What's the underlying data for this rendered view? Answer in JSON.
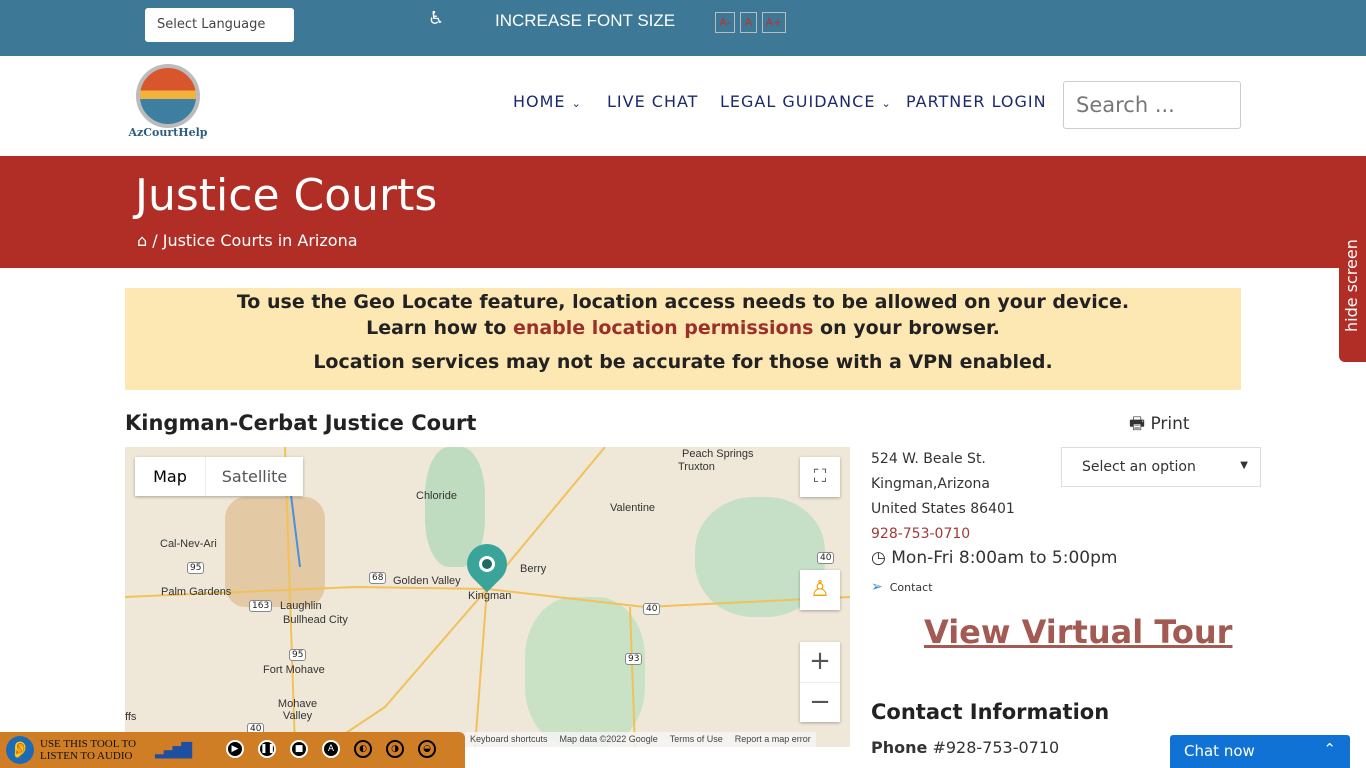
{
  "topbar": {
    "language_placeholder": "Select Language",
    "increase_font": "INCREASE FONT SIZE",
    "font_buttons": [
      "A-",
      "A",
      "A+"
    ]
  },
  "logo": {
    "text": "AzCourtHelp"
  },
  "nav": {
    "items": [
      {
        "label": "HOME",
        "dropdown": true
      },
      {
        "label": "LIVE CHAT"
      },
      {
        "label": "LEGAL GUIDANCE",
        "dropdown": true
      },
      {
        "label": "PARTNER LOGIN"
      }
    ],
    "search_placeholder": "Search ..."
  },
  "banner": {
    "title": "Justice Courts",
    "breadcrumb": "Justice Courts in Arizona"
  },
  "hide_screen": "hide screen",
  "notice": {
    "line1": "To use the Geo Locate feature, location access needs to be allowed on your device.",
    "line2_pre": "Learn how to ",
    "line2_link": "enable location permissions",
    "line2_post": " on your browser.",
    "line3": "Location services may not be accurate for those with a VPN enabled."
  },
  "court": {
    "name": "Kingman-Cerbat Justice Court",
    "print": "Print",
    "address1": "524 W. Beale St.",
    "address2": "Kingman,Arizona",
    "address3": "United States 86401",
    "phone_link": "928-753-0710",
    "hours": "Mon-Fri 8:00am to 5:00pm",
    "contact": "Contact",
    "select": "Select an option",
    "virtual_tour": "View Virtual Tour",
    "contact_heading": "Contact Information",
    "phone_label": "Phone",
    "phone_value": "#928-753-0710"
  },
  "map": {
    "type_tabs": [
      "Map",
      "Satellite"
    ],
    "places": [
      "Peach Springs",
      "Truxton",
      "Chloride",
      "Valentine",
      "Cal-Nev-Ari",
      "Golden Valley",
      "Berry",
      "Kingman",
      "Palm Gardens",
      "Laughlin",
      "Bullhead City",
      "Fort Mohave",
      "Mohave Valley",
      "ffs"
    ],
    "routes": [
      "95",
      "68",
      "163",
      "40",
      "40",
      "93",
      "95",
      "40"
    ],
    "footer": [
      "Keyboard shortcuts",
      "Map data ©2022 Google",
      "Terms of Use",
      "Report a map error"
    ],
    "zoom_in": "+",
    "zoom_out": "−"
  },
  "audio": {
    "label_line1": "USE THIS TOOL TO",
    "label_line2": "LISTEN TO AUDIO",
    "buttons": [
      "▶",
      "❚❚",
      "■",
      "A",
      "◐",
      "◑",
      "◒"
    ]
  },
  "chat": {
    "label": "Chat now"
  }
}
